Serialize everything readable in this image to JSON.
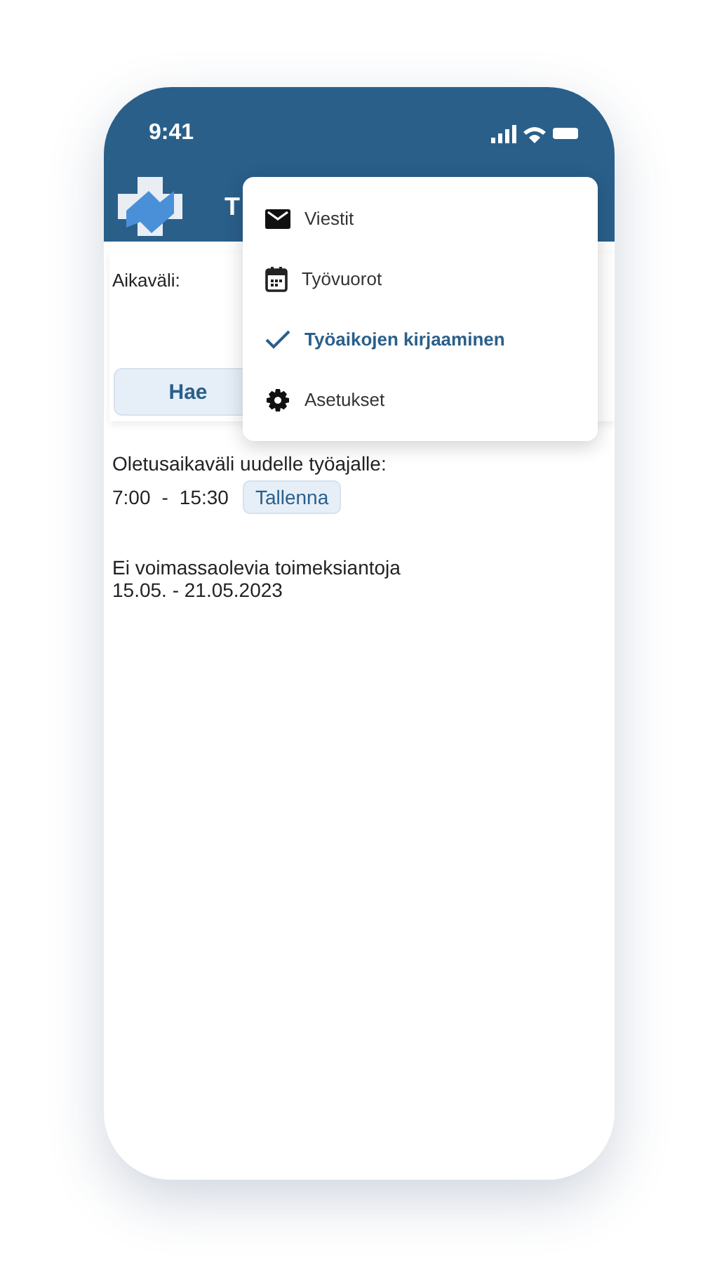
{
  "status_bar": {
    "time": "9:41"
  },
  "app_bar": {
    "title": "T"
  },
  "filter": {
    "label": "Aikaväli:",
    "button": "Hae"
  },
  "default_range": {
    "label": "Oletusaikaväli uudelle työajalle:",
    "start": "7:00",
    "separator": "-",
    "end": "15:30",
    "button": "Tallenna"
  },
  "notice": {
    "text": "Ei voimassaolevia toimeksiantoja",
    "range": "15.05. - 21.05.2023"
  },
  "menu": {
    "items": [
      {
        "label": "Viestit",
        "kind": "mail",
        "selected": false
      },
      {
        "label": "Työvuorot",
        "kind": "calendar",
        "selected": false
      },
      {
        "label": "Työaikojen kirjaaminen",
        "kind": "check",
        "selected": true
      },
      {
        "label": "Asetukset",
        "kind": "settings",
        "selected": false
      }
    ]
  }
}
